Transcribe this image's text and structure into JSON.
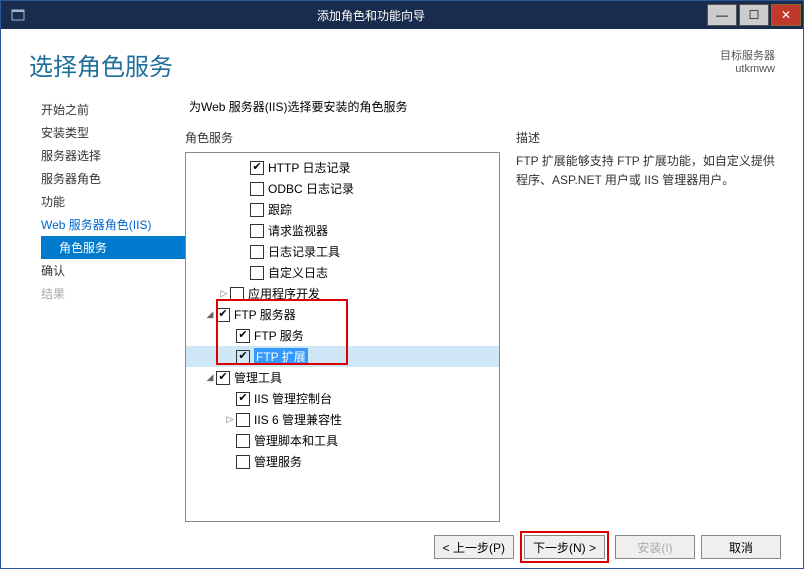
{
  "window": {
    "title": "添加角色和功能向导"
  },
  "header": {
    "page_title": "选择角色服务",
    "target_label": "目标服务器",
    "target_value": "utkmww"
  },
  "sidebar": {
    "items": [
      {
        "label": "开始之前",
        "cls": ""
      },
      {
        "label": "安装类型",
        "cls": ""
      },
      {
        "label": "服务器选择",
        "cls": ""
      },
      {
        "label": "服务器角色",
        "cls": ""
      },
      {
        "label": "功能",
        "cls": ""
      },
      {
        "label": "Web 服务器角色(IIS)",
        "cls": "link"
      },
      {
        "label": "角色服务",
        "cls": "active sub"
      },
      {
        "label": "确认",
        "cls": ""
      },
      {
        "label": "结果",
        "cls": "disabled"
      }
    ]
  },
  "main": {
    "instruction": "为Web 服务器(IIS)选择要安装的角色服务",
    "tree_label": "角色服务",
    "desc_label": "描述",
    "desc_text": "FTP 扩展能够支持 FTP 扩展功能，如自定义提供程序、ASP.NET 用户或 IIS 管理器用户。",
    "tree": [
      {
        "indent": "lvl1",
        "arrow": "",
        "checked": true,
        "label": "HTTP 日志记录"
      },
      {
        "indent": "lvl1",
        "arrow": "",
        "checked": false,
        "label": "ODBC 日志记录"
      },
      {
        "indent": "lvl1",
        "arrow": "",
        "checked": false,
        "label": "跟踪"
      },
      {
        "indent": "lvl1",
        "arrow": "",
        "checked": false,
        "label": "请求监视器"
      },
      {
        "indent": "lvl1",
        "arrow": "",
        "checked": false,
        "label": "日志记录工具"
      },
      {
        "indent": "lvl1",
        "arrow": "",
        "checked": false,
        "label": "自定义日志"
      },
      {
        "indent": "lvl0",
        "arrow": "▷",
        "checked": false,
        "label": "应用程序开发"
      },
      {
        "indent": "lvl-p0",
        "arrow": "◢",
        "checked": true,
        "label": "FTP 服务器",
        "group_start": true
      },
      {
        "indent": "lvl-p1",
        "arrow": "",
        "checked": true,
        "label": "FTP 服务"
      },
      {
        "indent": "lvl-p1",
        "arrow": "",
        "checked": true,
        "label": "FTP 扩展",
        "selected": true,
        "group_end": true
      },
      {
        "indent": "lvl-p0",
        "arrow": "◢",
        "checked": true,
        "label": "管理工具"
      },
      {
        "indent": "lvl-p1",
        "arrow": "",
        "checked": true,
        "label": "IIS 管理控制台"
      },
      {
        "indent": "lvl-p1",
        "arrow": "▷",
        "checked": false,
        "label": "IIS 6 管理兼容性"
      },
      {
        "indent": "lvl-p1",
        "arrow": "",
        "checked": false,
        "label": "管理脚本和工具"
      },
      {
        "indent": "lvl-p1",
        "arrow": "",
        "checked": false,
        "label": "管理服务"
      }
    ]
  },
  "footer": {
    "prev": "< 上一步(P)",
    "next": "下一步(N) >",
    "install": "安装(I)",
    "cancel": "取消"
  }
}
